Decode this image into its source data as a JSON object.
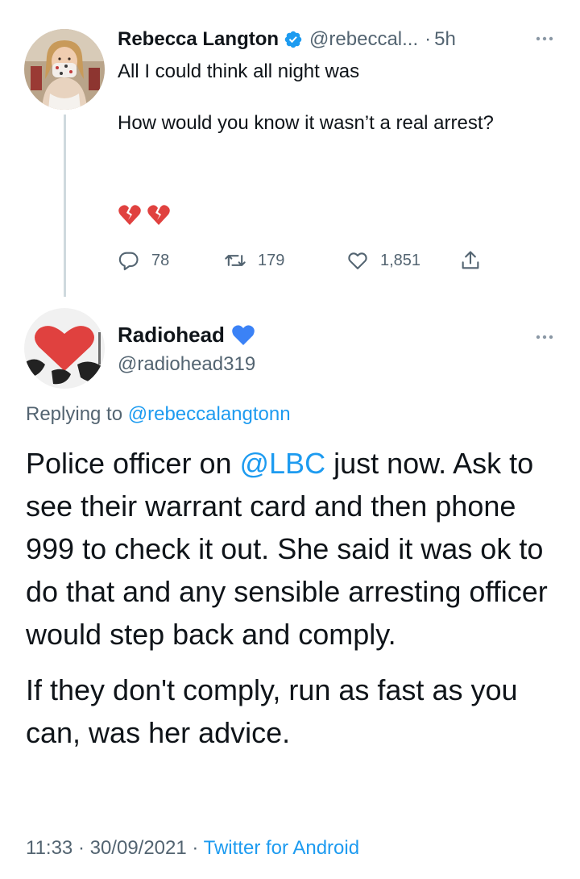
{
  "parent_tweet": {
    "display_name": "Rebecca Langton",
    "handle": "@rebeccal...",
    "separator": "·",
    "time": "5h",
    "text_line_1": "All I could think all night was",
    "text_line_2": "How would you know it wasn’t a real arrest?",
    "emoji": "💔💔",
    "reply_count": "78",
    "retweet_count": "179",
    "like_count": "1,851",
    "avatar_icon": "profile-photo-woman-with-mask"
  },
  "main_tweet": {
    "display_name": "Radiohead",
    "badge_icon": "blue-heart-icon",
    "handle": "@radiohead319",
    "replying_prefix": "Replying to",
    "replying_to": "@rebeccalangtonn",
    "text_before_mention": "Police officer on ",
    "mention": "@LBC",
    "text_after_mention": " just now. Ask to see their warrant card and then phone 999 to check it out.  She said it was ok to do that and any sensible arresting officer would step back and comply.",
    "text_paragraph_2": "If they don't comply, run as fast as you can, was her advice.",
    "timestamp": "11:33 · 30/09/2021",
    "meta_separator": "·",
    "source": "Twitter for Android",
    "avatar_icon": "red-heart-cow-pattern-avatar"
  },
  "colors": {
    "link": "#1d9bf0",
    "secondary_text": "#536471",
    "primary_text": "#0f1419",
    "heart_blue": "#3b82f6",
    "heart_red": "#e0413f"
  }
}
